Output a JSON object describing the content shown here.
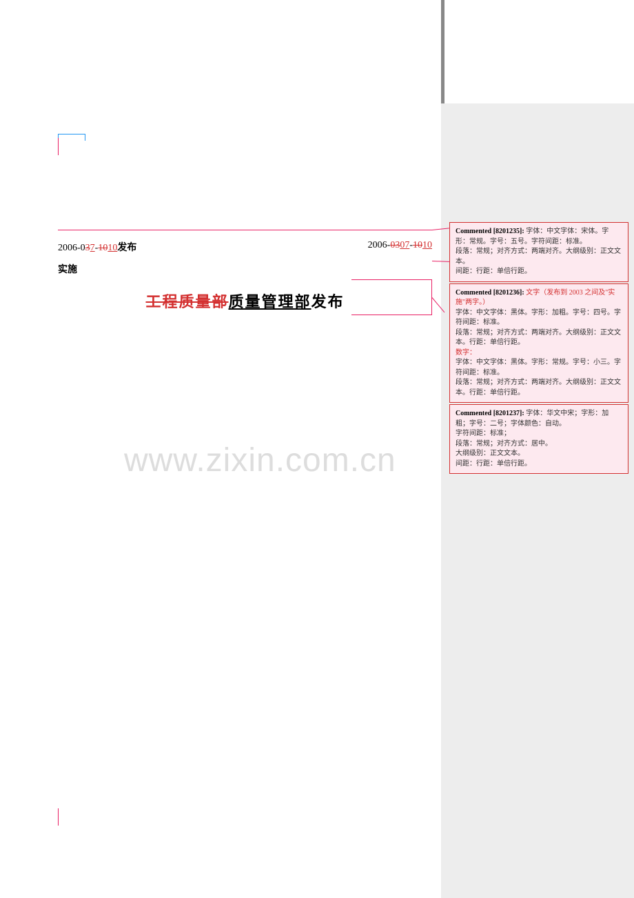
{
  "dates": {
    "left_prefix": "2006-0",
    "left_strike1": "3",
    "left_ins": "7",
    "left_dash": "-",
    "left_strike2": "10",
    "left_suffix": "10",
    "left_label": " 发布",
    "right_prefix": "2006-",
    "right_strike1": "03",
    "right_ins1": "07",
    "right_dash": " - ",
    "right_strike2": "10",
    "right_dash2": "  ",
    "right_suffix": "10"
  },
  "implement": "实施",
  "title": {
    "strike": "工程质量部",
    "normal_part1": "质量管理部",
    "normal_part2": "发布"
  },
  "comments": [
    {
      "label": "Commented [8201235]:",
      "body": "  字体：中文字体：宋体。字形：常规。字号：五号。字符间距：标准。\n段落：常规；对齐方式：两端对齐。大纲级别：正文文本。\n间距：行距：单倍行距。"
    },
    {
      "label": "Commented [8201236]:",
      "red_intro": "  文字（发布到 2003 之间及\"实施\"两字。）",
      "body": "字体：中文字体：黑体。字形：加粗。字号：四号。字符间距：标准。\n段落：常规；对齐方式：两端对齐。大纲级别：正文文本。行距：单倍行距。",
      "red_num": "数字：",
      "body2": "字体：中文字体：黑体。字形：常规。字号：小三。字符间距：标准。\n段落：常规；对齐方式：两端对齐。大纲级别：正文文本。行距：单倍行距。"
    },
    {
      "label": "Commented [8201237]:",
      "body": "  字体：华文中宋；字形：加粗；字号：二号；字体颜色：自动。\n字符间距：标准；\n段落：常规；对齐方式：居中。\n大纲级别：正文文本。\n间距：行距：单倍行距。"
    }
  ],
  "watermark": "www.zixin.com.cn"
}
